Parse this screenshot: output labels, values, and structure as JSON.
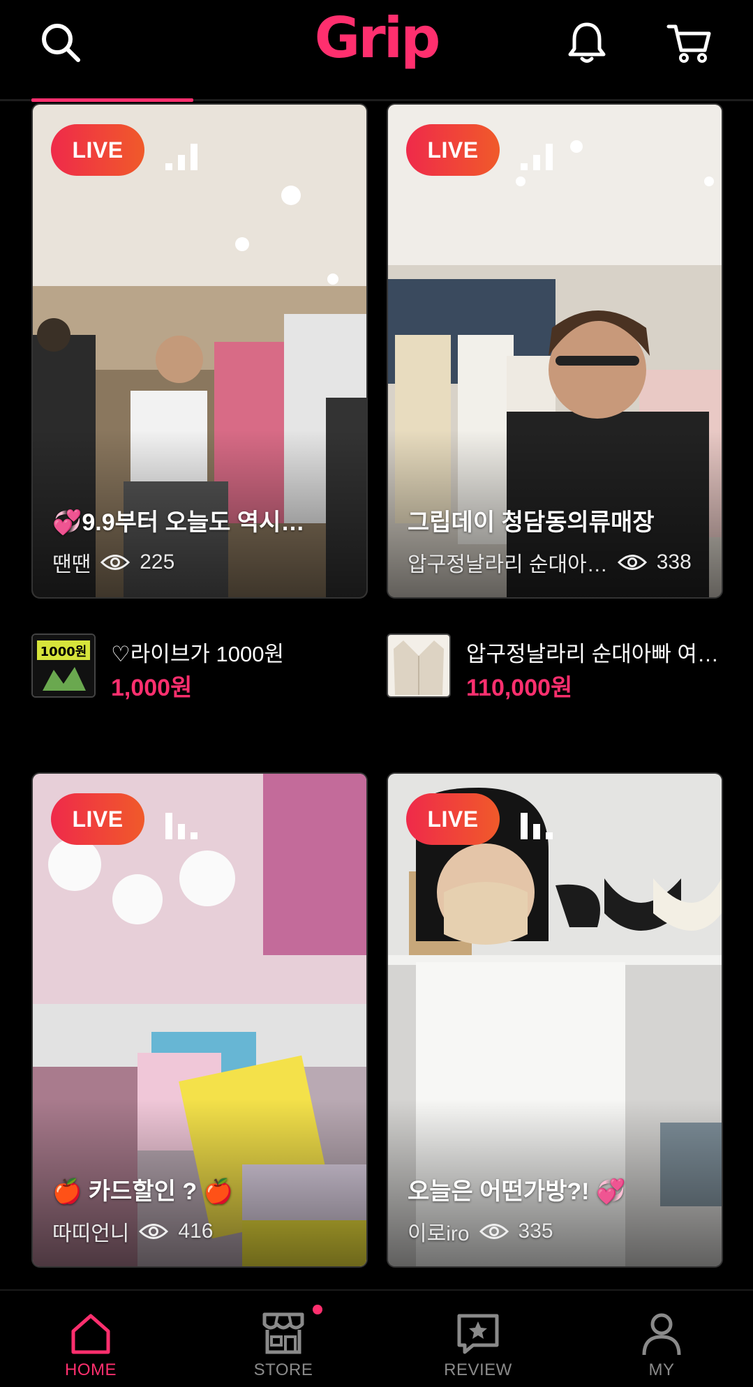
{
  "app": {
    "logo_text": "Grip",
    "accent_color": "#ff2f6e",
    "header_icons": [
      "search-icon",
      "bell-icon",
      "cart-icon"
    ]
  },
  "live_badge_label": "LIVE",
  "streams": [
    {
      "title": "💞9.9부터 오늘도 역시…",
      "streamer": "땐땐",
      "views": "225",
      "signal": "3 bars"
    },
    {
      "title": "그립데이 청담동의류매장",
      "streamer": "압구정날라리 순대아…",
      "views": "338",
      "signal": "3 bars"
    },
    {
      "title": "🍎 카드할인 ? 🍎",
      "streamer": "따띠언니",
      "views": "416",
      "signal": "3 bars"
    },
    {
      "title": "오늘은 어떤가방?! 💞",
      "streamer": "이로iro",
      "views": "335",
      "signal": "3 bars"
    }
  ],
  "products": [
    {
      "name": "♡라이브가 1000원",
      "price": "1,000원",
      "thumb_text": "1000원"
    },
    {
      "name": "압구정날라리 순대아빠 여…",
      "price": "110,000원"
    }
  ],
  "bottom_nav": {
    "items": [
      {
        "label": "HOME",
        "icon": "home-icon",
        "active": true
      },
      {
        "label": "STORE",
        "icon": "store-icon",
        "active": false,
        "badge_dot": true
      },
      {
        "label": "REVIEW",
        "icon": "review-icon",
        "active": false
      },
      {
        "label": "MY",
        "icon": "person-icon",
        "active": false
      }
    ]
  }
}
